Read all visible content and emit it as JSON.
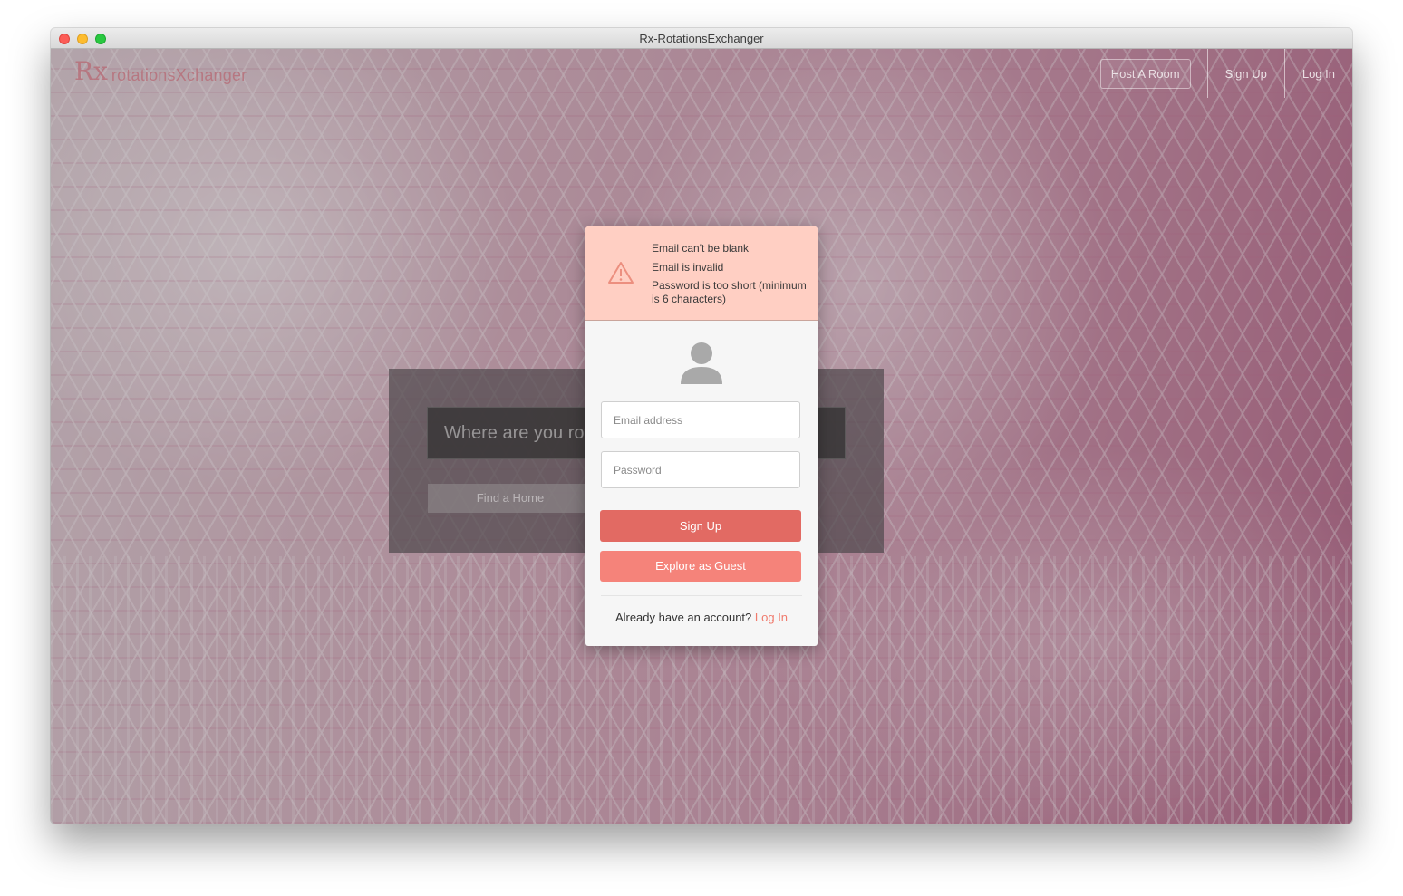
{
  "window": {
    "title": "Rx-RotationsExchanger"
  },
  "brand": {
    "mark": "Rx",
    "name": "rotationsXchanger"
  },
  "nav": {
    "host": "Host A Room",
    "signup": "Sign Up",
    "login": "Log In"
  },
  "search": {
    "placeholder": "Where are you rotati",
    "button": "Find a Home"
  },
  "errors": [
    "Email can't be blank",
    "Email is invalid",
    "Password is too short (minimum is 6 characters)"
  ],
  "form": {
    "email_placeholder": "Email address",
    "password_placeholder": "Password",
    "signup_button": "Sign Up",
    "guest_button": "Explore as Guest",
    "account_prompt": "Already have an account?",
    "login_link": "Log In"
  },
  "colors": {
    "primary_button": "#e26a63",
    "guest_button": "#f5837a",
    "error_background": "#ffcfc3",
    "link": "#f07a6c"
  },
  "icons": [
    "warning-icon",
    "user-avatar-icon"
  ]
}
